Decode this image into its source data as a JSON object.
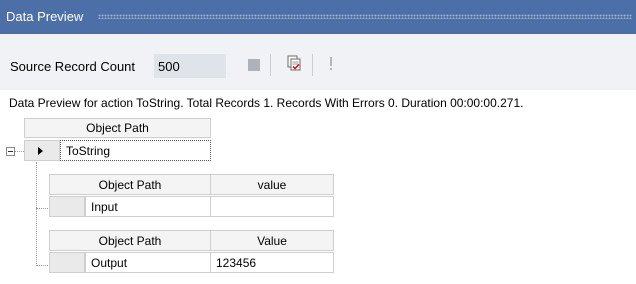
{
  "window": {
    "title": "Data Preview"
  },
  "toolbar": {
    "source_record_count_label": "Source Record Count",
    "source_record_count_value": "500",
    "stop_icon": "stop-icon",
    "preview_icon": "clipboard-check-icon",
    "warning_icon": "exclamation-icon"
  },
  "status_text": "Data Preview for action ToString. Total Records 1. Records With Errors 0. Duration 00:00:00.271.",
  "grid": {
    "top_header": "Object Path",
    "root_row": "ToString",
    "input_table": {
      "headers": [
        "Object Path",
        "value"
      ],
      "row": [
        "Input",
        ""
      ]
    },
    "output_table": {
      "headers": [
        "Object Path",
        "Value"
      ],
      "row": [
        "Output",
        "123456"
      ]
    }
  },
  "colors": {
    "titlebar": "#4d6fa8",
    "toolbar": "#f0f2f5"
  }
}
